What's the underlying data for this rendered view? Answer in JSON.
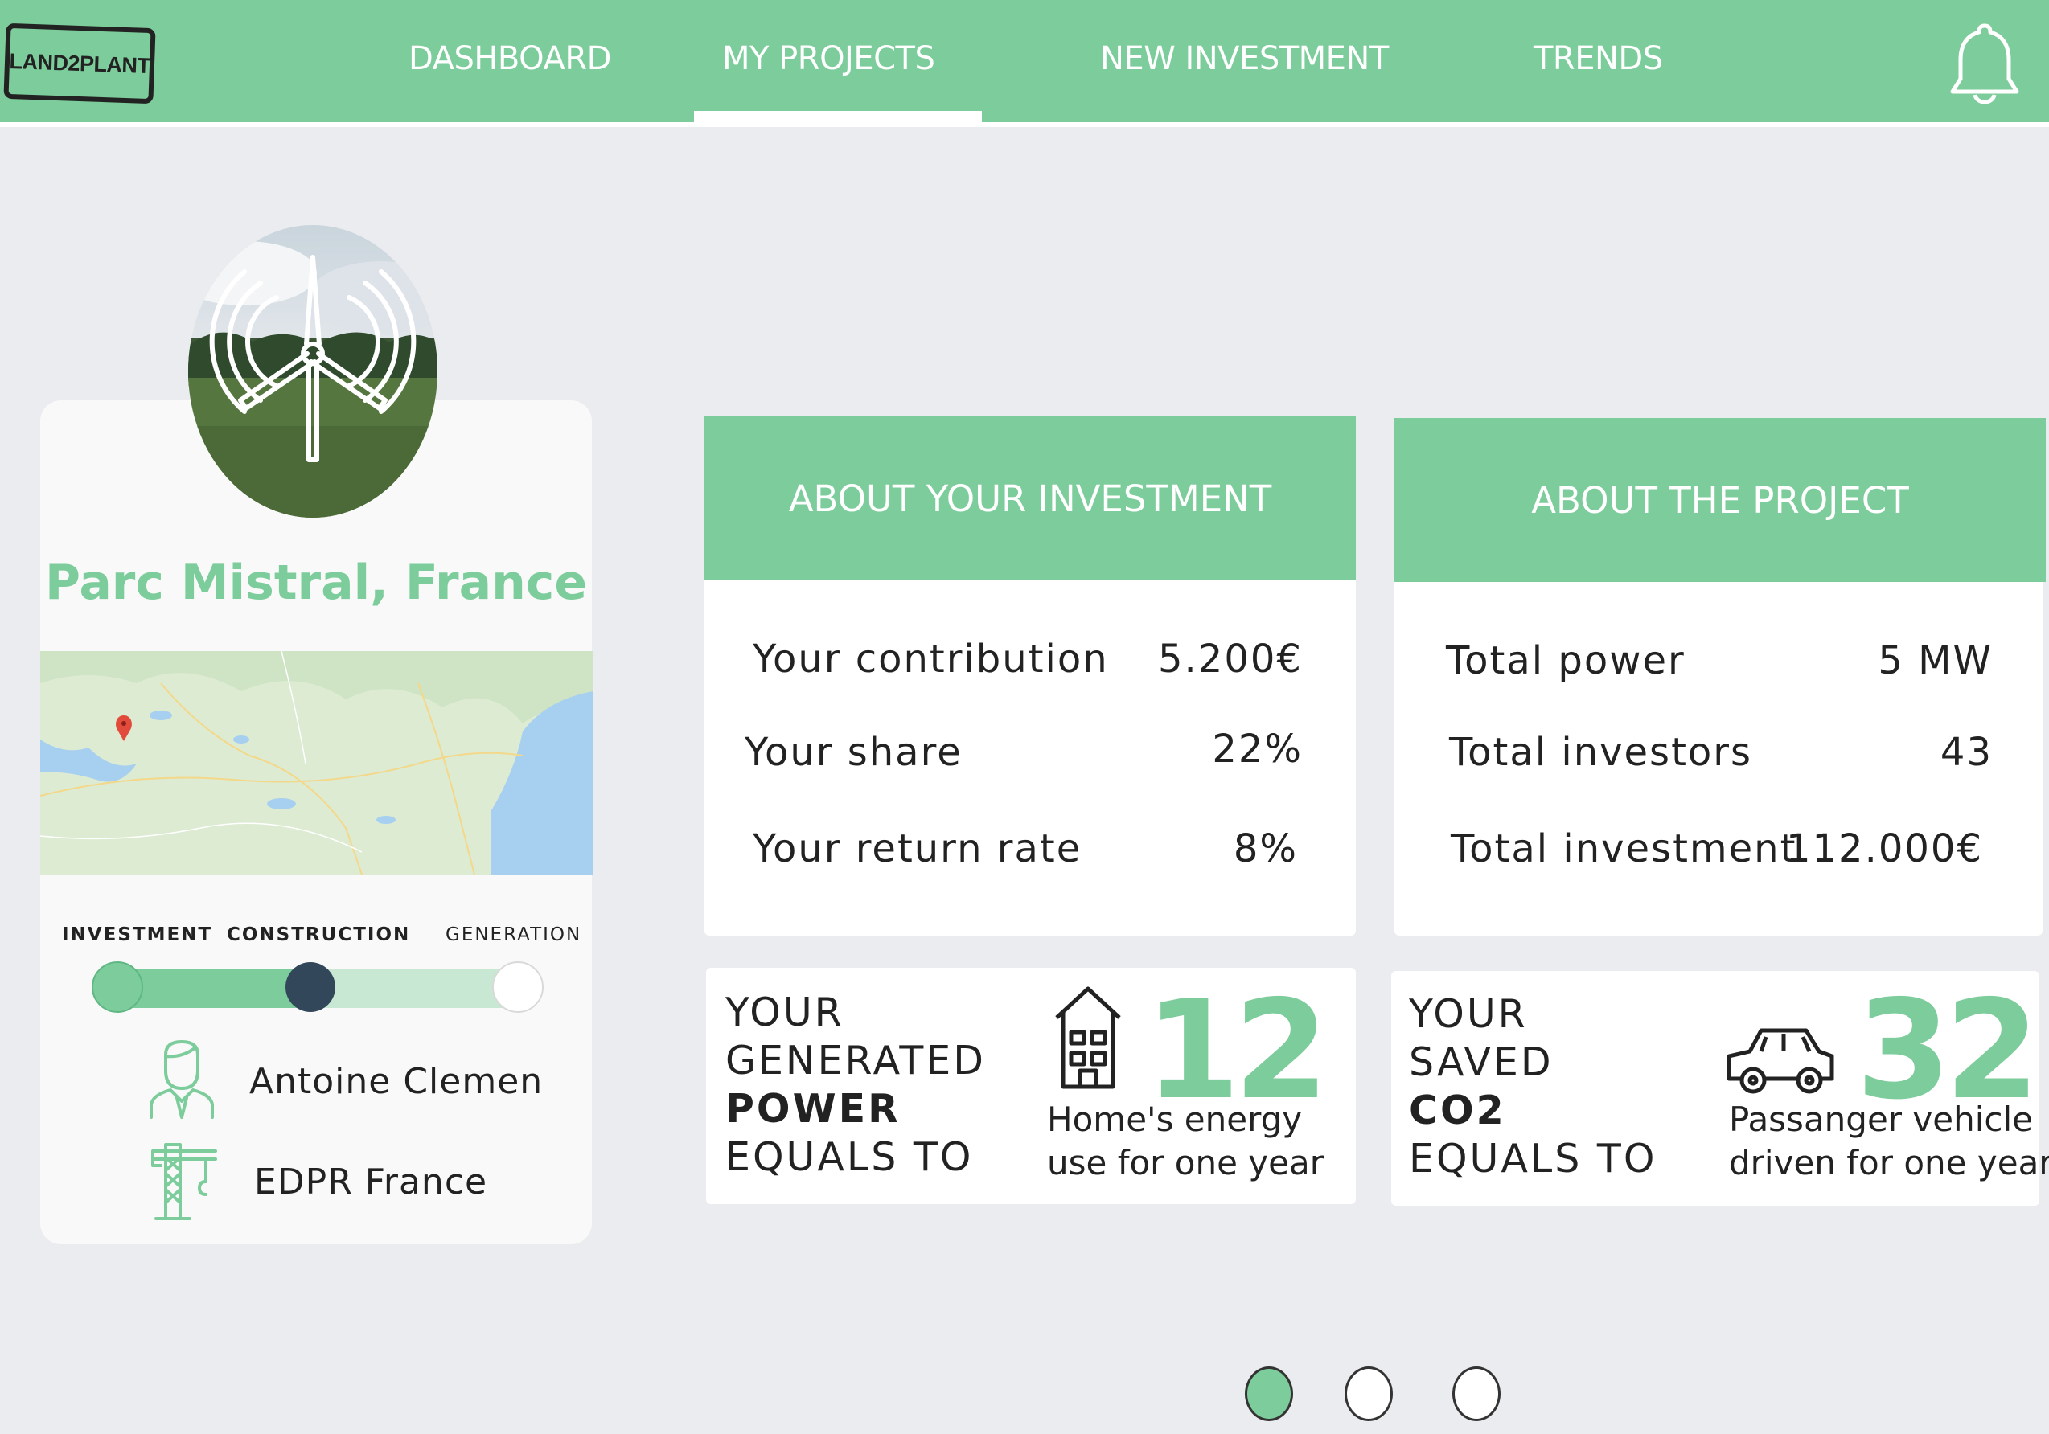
{
  "header": {
    "logo_text": "LAND2PLANT",
    "nav": [
      {
        "label": "DASHBOARD",
        "active": false
      },
      {
        "label": "MY PROJECTS",
        "active": true
      },
      {
        "label": "NEW INVESTMENT",
        "active": false
      },
      {
        "label": "TRENDS",
        "active": false
      }
    ],
    "bell_icon": "bell-icon"
  },
  "project": {
    "title": "Parc Mistral, France",
    "photo_icon": "wind-turbine-icon",
    "map_icon": "map-pin-icon",
    "stages": [
      {
        "label": "INVESTMENT",
        "state": "done"
      },
      {
        "label": "CONSTRUCTION",
        "state": "current"
      },
      {
        "label": "GENERATION",
        "state": "pending"
      }
    ],
    "contacts": [
      {
        "icon": "person-icon",
        "name": "Antoine Clemen"
      },
      {
        "icon": "crane-icon",
        "name": "EDPR France"
      }
    ]
  },
  "investment": {
    "heading": "ABOUT YOUR INVESTMENT",
    "rows": [
      {
        "label": "Your contribution",
        "value": "5.200€"
      },
      {
        "label": "Your share",
        "value": "22%"
      },
      {
        "label": "Your return rate",
        "value": "8%"
      }
    ]
  },
  "project_info": {
    "heading": "ABOUT THE PROJECT",
    "rows": [
      {
        "label": "Total power",
        "value": "5 MW"
      },
      {
        "label": "Total investors",
        "value": "43"
      },
      {
        "label": "Total investment",
        "value": "112.000€"
      }
    ]
  },
  "power_card": {
    "lines": [
      "YOUR",
      "GENERATED",
      "POWER",
      "EQUALS TO"
    ],
    "icon": "house-icon",
    "number": "12",
    "caption_lines": [
      "Home's energy",
      "use for one year"
    ]
  },
  "co2_card": {
    "lines": [
      "YOUR",
      "SAVED",
      "CO2",
      "EQUALS TO"
    ],
    "icon": "car-icon",
    "number": "32",
    "caption_lines": [
      "Passanger vehicle",
      "driven for one year"
    ]
  },
  "pager": {
    "pages": 3,
    "active_page": 1
  },
  "colors": {
    "accent": "#7dcc9b",
    "background": "#ebecef",
    "stage_current": "#33475b",
    "text": "#222222"
  }
}
